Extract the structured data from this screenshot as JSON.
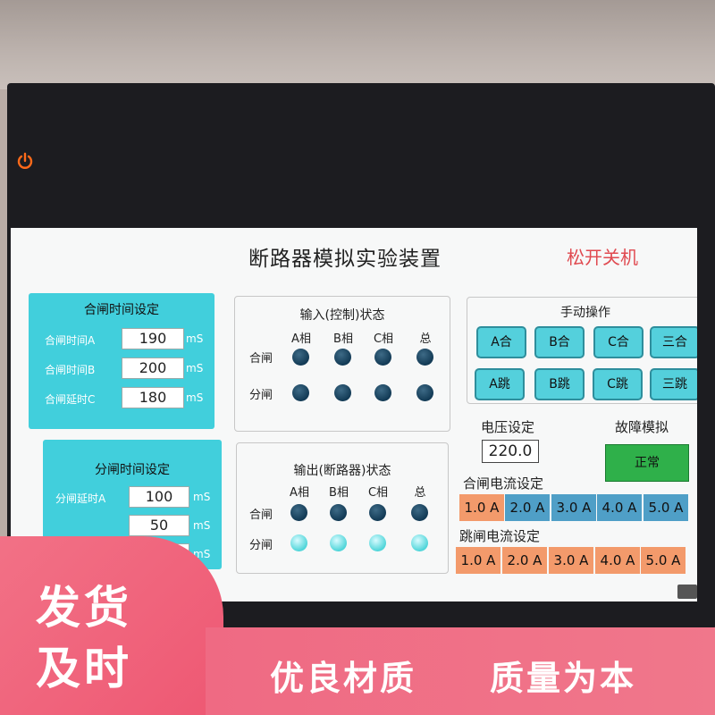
{
  "screen": {
    "title": "断路器模拟实验装置",
    "power_off": "松开关机"
  },
  "close_time": {
    "title": "合闸时间设定",
    "rows": [
      {
        "label": "合闸时间A",
        "value": "190",
        "unit": "mS"
      },
      {
        "label": "合闸时间B",
        "value": "200",
        "unit": "mS"
      },
      {
        "label": "合闸延时C",
        "value": "180",
        "unit": "mS"
      }
    ]
  },
  "open_time": {
    "title": "分闸时间设定",
    "rows": [
      {
        "label": "分闸延时A",
        "value": "100",
        "unit": "mS"
      },
      {
        "label": "",
        "value": "50",
        "unit": "mS"
      },
      {
        "label": "",
        "value": "",
        "unit": "mS"
      }
    ]
  },
  "input_status": {
    "title": "输入(控制)状态",
    "columns": [
      "A相",
      "B相",
      "C相",
      "总"
    ],
    "rows": [
      "合闸",
      "分闸"
    ]
  },
  "output_status": {
    "title": "输出(断路器)状态",
    "columns": [
      "A相",
      "B相",
      "C相",
      "总"
    ],
    "rows": [
      "合闸",
      "分闸"
    ]
  },
  "manual": {
    "title": "手动操作",
    "buttons": [
      "A合",
      "B合",
      "C合",
      "三合",
      "A跳",
      "B跳",
      "C跳",
      "三跳"
    ]
  },
  "voltage": {
    "label": "电压设定",
    "value": "220.0"
  },
  "fault": {
    "label": "故障模拟",
    "button": "正常"
  },
  "close_current": {
    "label": "合闸电流设定",
    "options": [
      "1.0 A",
      "2.0 A",
      "3.0 A",
      "4.0 A",
      "5.0 A"
    ]
  },
  "trip_current": {
    "label": "跳闸电流设定",
    "options": [
      "1.0 A",
      "2.0 A",
      "3.0 A",
      "4.0 A",
      "5.0 A"
    ]
  },
  "promo": {
    "left_line1": "发货",
    "left_line2": "及时",
    "right_text1": "优良材质",
    "right_text2": "质量为本"
  },
  "colors": {
    "panel_cyan": "#41cfdc",
    "promo_pink": "#ee5873",
    "fault_green": "#2fb04a",
    "current_orange": "#f39a6b",
    "current_blue": "#4f9fc7"
  }
}
